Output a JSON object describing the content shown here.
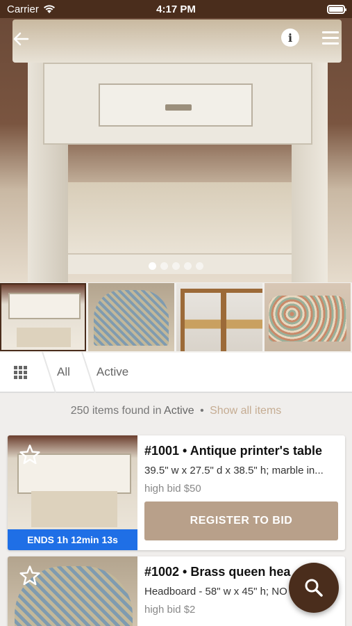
{
  "status_bar": {
    "carrier": "Carrier",
    "time": "4:17 PM"
  },
  "hero": {
    "carousel_total": 5,
    "carousel_active_index": 0
  },
  "tabs": {
    "crumbs": [
      "All",
      "Active"
    ]
  },
  "results": {
    "count_text": "250 items found in",
    "filter": "Active",
    "separator": "•",
    "show_all": "Show all items"
  },
  "items": [
    {
      "title": "#1001 • Antique printer's table",
      "description": "39.5\" w x 27.5\" d x 38.5\" h; marble in...",
      "bid": "high bid $50",
      "ends": "ENDS 1h 12min 13s",
      "button": "REGISTER TO BID"
    },
    {
      "title": "#1002 • Brass queen hea",
      "description": "Headboard - 58\" w x 45\" h; NO",
      "bid": "high bid $2"
    }
  ],
  "colors": {
    "brand_brown": "#4a2d1c",
    "accent_tan": "#b8a08a",
    "ends_blue": "#1f6fe6",
    "link_tan": "#c5ac92"
  }
}
